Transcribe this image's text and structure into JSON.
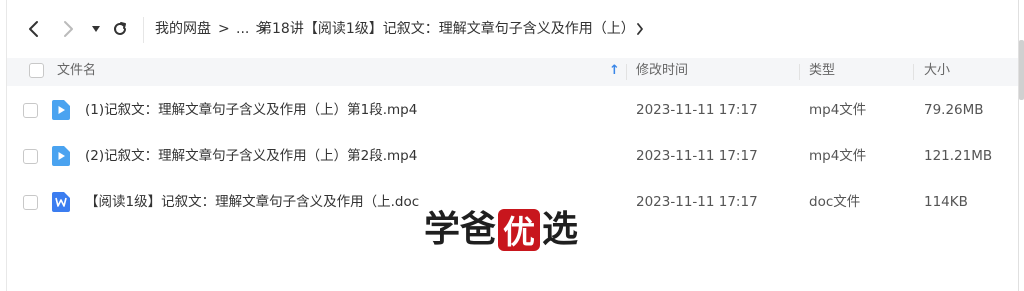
{
  "breadcrumb": {
    "root": "我的网盘",
    "sep": ">",
    "ellipsis": "...",
    "current": "第18讲【阅读1级】记叙文：理解文章句子含义及作用（上）"
  },
  "table": {
    "headers": {
      "name": "文件名",
      "modified": "修改时间",
      "type": "类型",
      "size": "大小"
    },
    "sort_indicator": "↑",
    "rows": [
      {
        "name": "(1)记叙文：理解文章句子含义及作用（上）第1段.mp4",
        "modified": "2023-11-11 17:17",
        "type": "mp4文件",
        "size": "79.26MB",
        "icon": "video-file-icon"
      },
      {
        "name": "(2)记叙文：理解文章句子含义及作用（上）第2段.mp4",
        "modified": "2023-11-11 17:17",
        "type": "mp4文件",
        "size": "121.21MB",
        "icon": "video-file-icon"
      },
      {
        "name": "【阅读1级】记叙文：理解文章句子含义及作用（上.doc",
        "modified": "2023-11-11 17:17",
        "type": "doc文件",
        "size": "114KB",
        "icon": "word-file-icon"
      }
    ]
  },
  "watermark": {
    "c1": "学",
    "c2": "爸",
    "c3": "优",
    "c4": "选"
  },
  "colors": {
    "video_icon": "#4aa3f0",
    "word_icon": "#3b7df0",
    "seal": "#c8161d"
  }
}
